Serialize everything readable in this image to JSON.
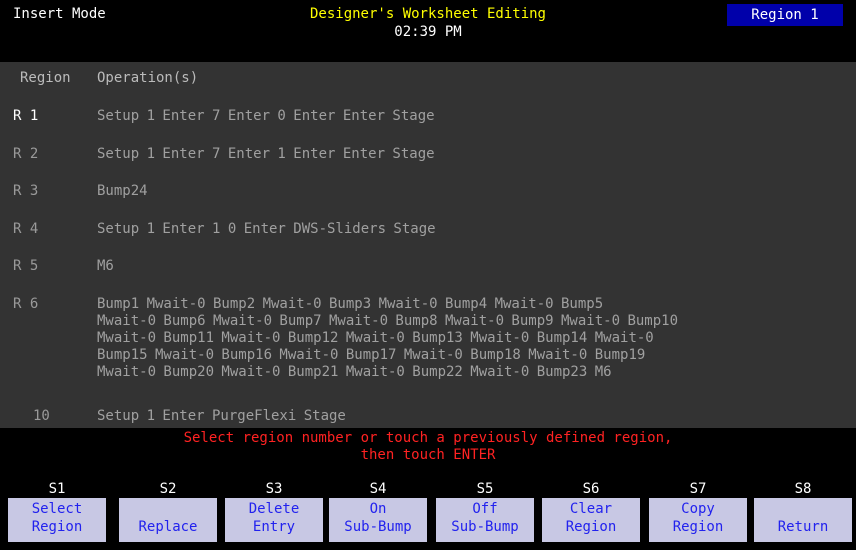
{
  "header": {
    "mode": "Insert Mode",
    "title": "Designer's Worksheet Editing",
    "time": "02:39 PM",
    "region_badge": "Region 1"
  },
  "table": {
    "col_region": "Region",
    "col_operations": "Operation(s)",
    "rows": [
      {
        "label": "R 1",
        "ops": "Setup 1 Enter 7 Enter 0 Enter Enter Stage"
      },
      {
        "label": "R 2",
        "ops": "Setup 1 Enter 7 Enter 1 Enter Enter Stage"
      },
      {
        "label": "R 3",
        "ops": "Bump24"
      },
      {
        "label": "R 4",
        "ops": "Setup 1 Enter 1 0 Enter DWS-Sliders Stage"
      },
      {
        "label": "R 5",
        "ops": "M6"
      },
      {
        "label": "R 6",
        "ops": "Bump1 Mwait-0 Bump2 Mwait-0 Bump3 Mwait-0 Bump4 Mwait-0 Bump5\nMwait-0 Bump6 Mwait-0 Bump7 Mwait-0 Bump8 Mwait-0 Bump9 Mwait-0 Bump10\nMwait-0 Bump11 Mwait-0 Bump12 Mwait-0 Bump13 Mwait-0 Bump14 Mwait-0\nBump15 Mwait-0 Bump16 Mwait-0 Bump17 Mwait-0 Bump18 Mwait-0 Bump19\nMwait-0 Bump20 Mwait-0 Bump21 Mwait-0 Bump22 Mwait-0 Bump23 M6"
      },
      {
        "label": "10",
        "ops": "Setup 1 Enter PurgeFlexi Stage"
      }
    ]
  },
  "prompt": {
    "line1": "Select region number or touch a previously defined region,",
    "line2": "then touch ENTER"
  },
  "softkeys": [
    {
      "num": "S1",
      "line1": "Select",
      "line2": "Region"
    },
    {
      "num": "S2",
      "line1": "Replace",
      "line2": ""
    },
    {
      "num": "S3",
      "line1": "Delete",
      "line2": "Entry"
    },
    {
      "num": "S4",
      "line1": "On",
      "line2": "Sub-Bump"
    },
    {
      "num": "S5",
      "line1": "Off",
      "line2": "Sub-Bump"
    },
    {
      "num": "S6",
      "line1": "Clear",
      "line2": "Region"
    },
    {
      "num": "S7",
      "line1": "Copy",
      "line2": "Region"
    },
    {
      "num": "S8",
      "line1": "Return",
      "line2": ""
    }
  ],
  "colors": {
    "title": "#ffff00",
    "badge_bg": "#0000aa",
    "prompt": "#ff2222",
    "softkey_bg": "#c8c8e4",
    "softkey_text": "#2222ee",
    "list_bg": "#333333"
  }
}
